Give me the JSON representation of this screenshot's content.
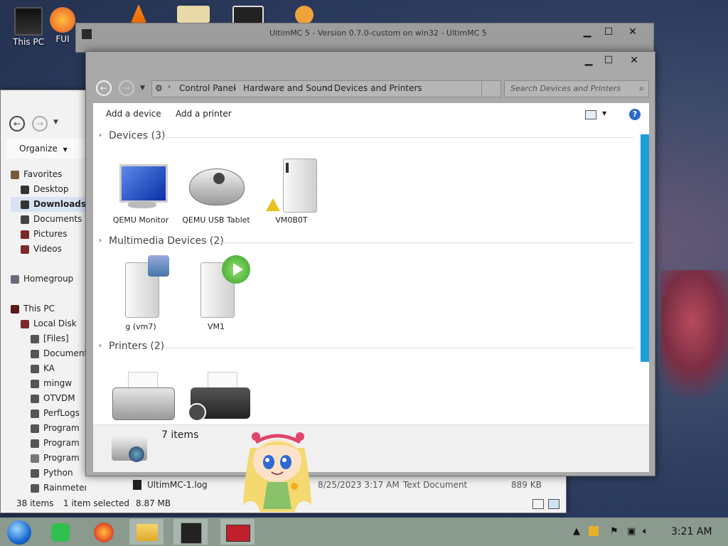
{
  "desktop": {
    "icons": [
      {
        "label": "This PC"
      },
      {
        "label": "FUI"
      }
    ]
  },
  "bg_window": {
    "organize_label": "Organize",
    "tree": [
      {
        "label": "Favorites"
      },
      {
        "label": "Desktop"
      },
      {
        "label": "Downloads"
      },
      {
        "label": "Documents"
      },
      {
        "label": "Pictures"
      },
      {
        "label": "Videos"
      },
      {
        "label": ""
      },
      {
        "label": "Homegroup"
      },
      {
        "label": ""
      },
      {
        "label": "This PC"
      },
      {
        "label": "Local Disk"
      },
      {
        "label": "[Files]"
      },
      {
        "label": "Documents"
      },
      {
        "label": "KA"
      },
      {
        "label": "mingw"
      },
      {
        "label": "OTVDM"
      },
      {
        "label": "PerfLogs"
      },
      {
        "label": "Program"
      },
      {
        "label": "Program"
      },
      {
        "label": "Program"
      },
      {
        "label": "Python"
      },
      {
        "label": "Rainmeter"
      }
    ],
    "file_row": {
      "name": "UltimMC-1.log",
      "date": "8/25/2023 3:17 AM",
      "type": "Text Document",
      "size": "889 KB"
    },
    "status": {
      "count": "38 items",
      "selection": "1 item selected",
      "size": "8.87 MB"
    }
  },
  "umc_window": {
    "title": "UltimMC 5 - Version 0.7.0-custom on win32 - UltimMC 5"
  },
  "window": {
    "address": {
      "crumbs": [
        "Control Panel",
        "Hardware and Sound",
        "Devices and Printers"
      ],
      "search_placeholder": "Search Devices and Printers"
    },
    "toolbar": {
      "add_device": "Add a device",
      "add_printer": "Add a printer",
      "help": "?"
    },
    "groups": [
      {
        "title": "Devices (3)",
        "devices": [
          "QEMU Monitor",
          "QEMU USB Tablet",
          "VM0B0T"
        ]
      },
      {
        "title": "Multimedia Devices (2)",
        "devices": [
          "g (vm7)",
          "VM1"
        ]
      },
      {
        "title": "Printers (2)",
        "devices": [
          "",
          ""
        ]
      }
    ],
    "details": {
      "count": "7 items"
    }
  },
  "taskbar": {
    "clock": "3:21 AM"
  },
  "colors": {
    "accent": "#1aa0d8",
    "taskbar": "#8a9a8e"
  }
}
